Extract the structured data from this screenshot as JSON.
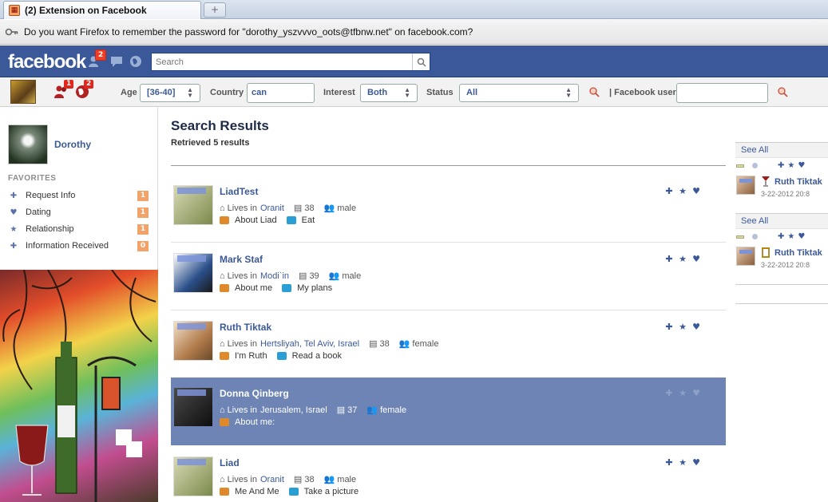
{
  "browser": {
    "tab_title": "(2) Extension on Facebook",
    "newtab_label": "+",
    "notification": "Do you want Firefox to remember the password for \"dorothy_yszvvvo_oots@tfbnw.net\" on facebook.com?"
  },
  "facebook": {
    "logo": "facebook",
    "friend_requests_badge": "2",
    "search_placeholder": "Search"
  },
  "filters": {
    "ext_badge_1": "1",
    "ext_badge_2": "2",
    "age_label": "Age",
    "age_value": "[36-40]",
    "country_label": "Country",
    "country_value": "can",
    "interest_label": "Interest",
    "interest_value": "Both",
    "status_label": "Status",
    "status_value": "All",
    "fb_user_label": "| Facebook user",
    "fb_user_value": ""
  },
  "sidebar": {
    "profile_name": "Dorothy",
    "favorites_title": "FAVORITES",
    "items": [
      {
        "icon": "plus-icon",
        "label": "Request Info",
        "count": "1"
      },
      {
        "icon": "heart-icon",
        "label": "Dating",
        "count": "1"
      },
      {
        "icon": "star-icon",
        "label": "Relationship",
        "count": "1"
      },
      {
        "icon": "plus-icon",
        "label": "Information Received",
        "count": "0"
      }
    ]
  },
  "results": {
    "title": "Search Results",
    "subtitle": "Retrieved 5 results",
    "rows": [
      {
        "name": "LiadTest",
        "lives_prefix": "Lives in",
        "location": "Oranit",
        "age": "38",
        "gender": "male",
        "link1": "About Liad",
        "link2": "Eat",
        "avatar_color": "#8a9a6a",
        "active": false
      },
      {
        "name": "Mark Staf",
        "lives_prefix": "Lives in",
        "location": "Modi`in",
        "age": "39",
        "gender": "male",
        "link1": "About me",
        "link2": "My plans",
        "avatar_color": "#3d5a8a",
        "active": false
      },
      {
        "name": "Ruth Tiktak",
        "lives_prefix": "Lives in",
        "location": "Hertsliyah, Tel Aviv, Israel",
        "age": "38",
        "gender": "female",
        "link1": "I'm Ruth",
        "link2": "Read a book",
        "avatar_color": "#c9a27a",
        "active": false
      },
      {
        "name": "Donna Qinberg",
        "lives_prefix": "Lives in",
        "location": "Jerusalem, Israel",
        "age": "37",
        "gender": "female",
        "link1": "About me:",
        "link2": "",
        "avatar_color": "#2a2a2a",
        "active": true
      },
      {
        "name": "Liad",
        "lives_prefix": "Lives in",
        "location": "Oranit",
        "age": "38",
        "gender": "male",
        "link1": "Me And Me",
        "link2": "Take a picture",
        "avatar_color": "#8a9a6a",
        "active": false
      }
    ]
  },
  "rightcol": {
    "blocks": [
      {
        "see_all": "See All",
        "name": "Ruth Tiktak",
        "date": "3-22-2012 20:8"
      },
      {
        "see_all": "See All",
        "name": "Ruth Tiktak",
        "date": "3-22-2012 20:8"
      }
    ]
  },
  "colors": {
    "fb_blue": "#3b5998",
    "active_row": "#6d84b4",
    "badge_red": "#f03d25",
    "count_orange": "#f2a36a"
  }
}
